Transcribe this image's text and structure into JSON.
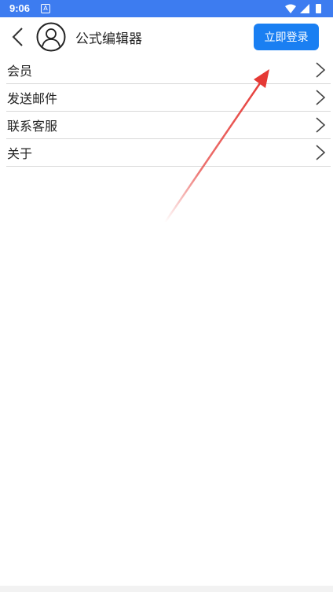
{
  "status_bar": {
    "time": "9:06",
    "notification_glyph": "A",
    "icons": [
      "wifi-icon",
      "signal-icon",
      "battery-icon"
    ]
  },
  "header": {
    "title": "公式编辑器",
    "login_label": "立即登录",
    "accent_color": "#1a7ff2"
  },
  "menu": {
    "items": [
      {
        "label": "会员"
      },
      {
        "label": "发送邮件"
      },
      {
        "label": "联系客服"
      },
      {
        "label": "关于"
      }
    ]
  },
  "colors": {
    "status_bar": "#3d7cf0",
    "annotation_arrow": "#e53935"
  }
}
